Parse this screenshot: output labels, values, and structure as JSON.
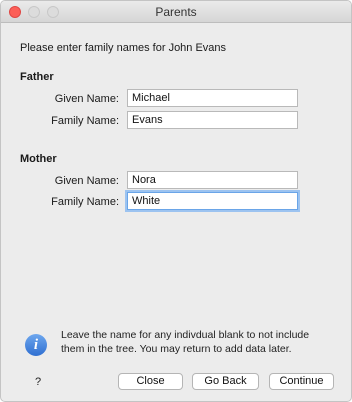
{
  "window": {
    "title": "Parents"
  },
  "intro": "Please enter family names for John Evans",
  "father": {
    "heading": "Father",
    "given_label": "Given Name:",
    "given_value": "Michael",
    "family_label": "Family Name:",
    "family_value": "Evans"
  },
  "mother": {
    "heading": "Mother",
    "given_label": "Given Name:",
    "given_value": "Nora",
    "family_label": "Family Name:",
    "family_value": "White"
  },
  "info": {
    "icon": "info-icon",
    "text": "Leave the name for any indivdual blank to not include them in the tree. You may return to add data later."
  },
  "buttons": {
    "help": "?",
    "close": "Close",
    "go_back": "Go Back",
    "continue": "Continue"
  },
  "colors": {
    "close_light": "#fc5f57",
    "focus_ring": "#9cc3f0",
    "info_blue": "#2f6fd1"
  }
}
